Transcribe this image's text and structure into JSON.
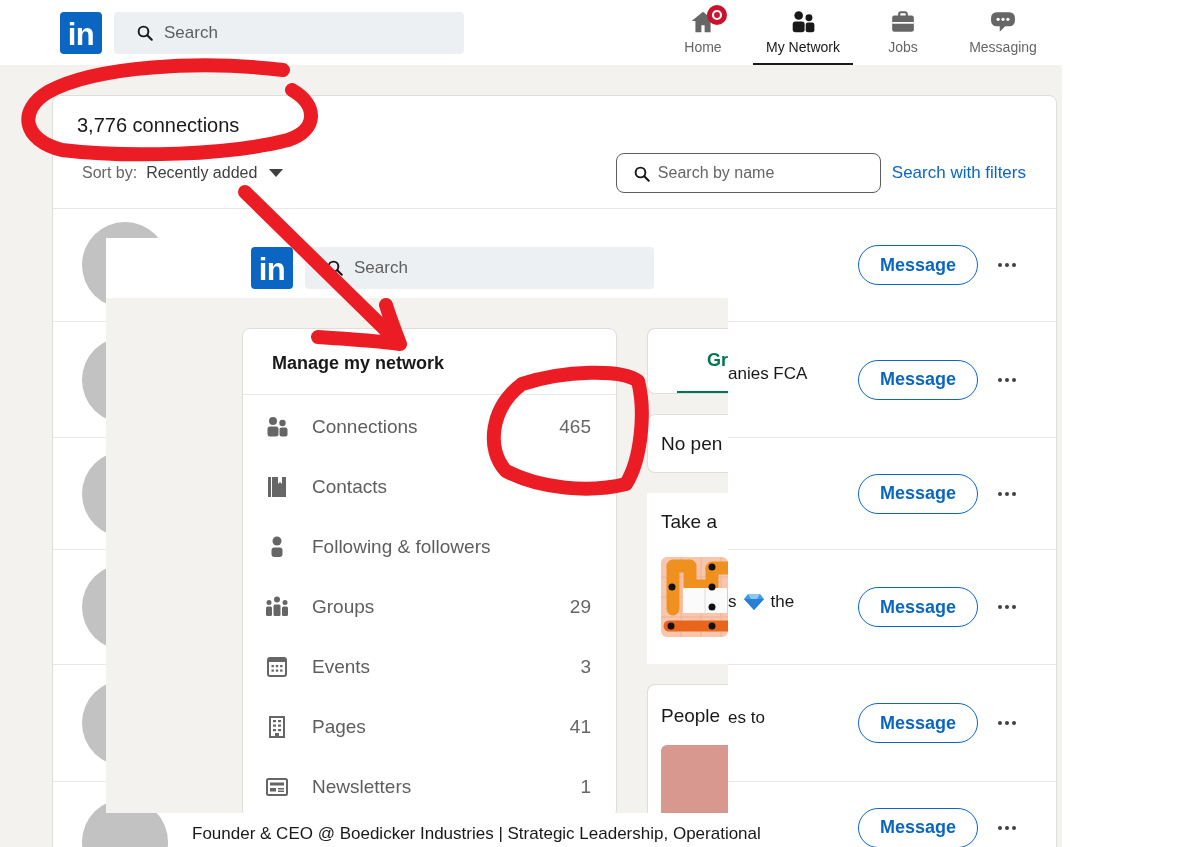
{
  "top_nav": {
    "logo": "in",
    "search": {
      "placeholder": "Search"
    },
    "items": [
      {
        "label": "Home",
        "selected": false,
        "badge": true
      },
      {
        "label": "My Network",
        "selected": true,
        "badge": false
      },
      {
        "label": "Jobs",
        "selected": false,
        "badge": false
      },
      {
        "label": "Messaging",
        "selected": false,
        "badge": false
      }
    ]
  },
  "connections_card": {
    "title": "3,776 connections",
    "sort_label": "Sort by:",
    "sort_value": "Recently added",
    "name_search": {
      "placeholder": "Search by name"
    },
    "filters_link": "Search with filters",
    "rows": [
      {
        "button": "Message"
      },
      {
        "headline_tail": [
          {
            "kind": "text",
            "text": "anies FCA"
          }
        ],
        "button": "Message"
      },
      {
        "button": "Message"
      },
      {
        "headline_tail": [
          {
            "kind": "text",
            "text": "s"
          },
          {
            "kind": "emoji"
          },
          {
            "kind": "text",
            "text": "the"
          }
        ],
        "button": "Message"
      },
      {
        "headline_tail": [
          {
            "kind": "text",
            "text": "es to"
          }
        ],
        "button": "Message"
      },
      {
        "headline": "Founder & CEO @ Boedicker Industries | Strategic Leadership, Operational",
        "button": "Message"
      }
    ]
  },
  "inset_screenshot": {
    "logo": "in",
    "search": {
      "placeholder": "Search"
    },
    "manage_card": {
      "title": "Manage my network",
      "items": [
        {
          "label": "Connections",
          "count": "465"
        },
        {
          "label": "Contacts"
        },
        {
          "label": "Following & followers"
        },
        {
          "label": "Groups",
          "count": "29"
        },
        {
          "label": "Events",
          "count": "3"
        },
        {
          "label": "Pages",
          "count": "41"
        },
        {
          "label": "Newsletters",
          "count": "1"
        }
      ]
    },
    "side_cards": [
      {
        "kind": "tab",
        "label": "Gr",
        "selected": true
      },
      {
        "kind": "notice",
        "text": "No pen"
      },
      {
        "kind": "game",
        "text": "Take a"
      },
      {
        "kind": "people",
        "text": "People"
      }
    ]
  }
}
